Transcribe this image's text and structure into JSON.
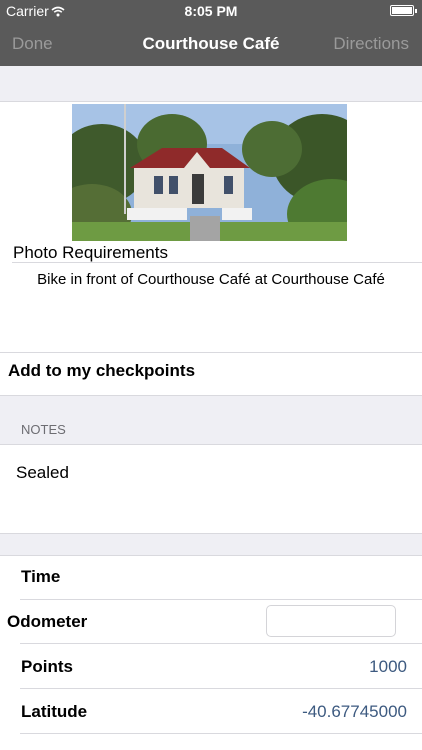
{
  "status": {
    "carrier": "Carrier",
    "time": "8:05 PM"
  },
  "nav": {
    "left": "Done",
    "title": "Courthouse Café",
    "right": "Directions"
  },
  "photo": {
    "alt": "Courthouse Café building"
  },
  "requirements": {
    "heading": "Photo Requirements",
    "text": "Bike in front of Courthouse Café at Courthouse Café"
  },
  "checkpoint": {
    "label": "Add to my checkpoints"
  },
  "notes": {
    "header": "NOTES",
    "text": "Sealed"
  },
  "details": {
    "time_label": "Time",
    "odometer_label": "Odometer",
    "odometer_value": "",
    "points_label": "Points",
    "points_value": "1000",
    "latitude_label": "Latitude",
    "latitude_value": "-40.67745000"
  }
}
